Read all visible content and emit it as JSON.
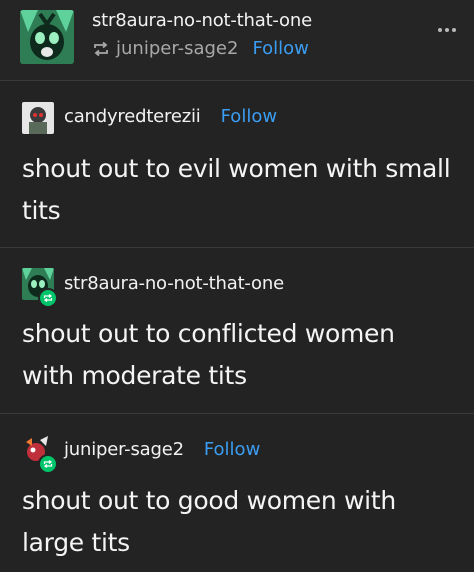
{
  "header": {
    "blog_name": "str8aura-no-not-that-one",
    "reblogged_from": "juniper-sage2",
    "follow_label": "Follow",
    "more_icon": "ellipsis-icon"
  },
  "posts": [
    {
      "author": "candyredterezii",
      "follow_label": "Follow",
      "text": "shout out to evil women with small tits"
    },
    {
      "author": "str8aura-no-not-that-one",
      "follow_label": "",
      "text": "shout out to conflicted women with moderate tits"
    },
    {
      "author": "juniper-sage2",
      "follow_label": "Follow",
      "text": "shout out to good women with large tits"
    }
  ],
  "colors": {
    "background": "#232323",
    "link": "#3b9df2",
    "reblog_badge": "#00c46a"
  }
}
